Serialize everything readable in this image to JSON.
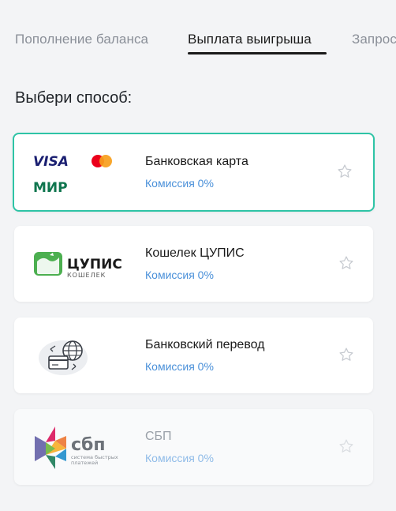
{
  "tabs": [
    {
      "label": "Пополнение баланса",
      "active": false
    },
    {
      "label": "Выплата выигрыша",
      "active": true
    },
    {
      "label": "Запрос",
      "active": false
    }
  ],
  "section_title": "Выбери способ:",
  "methods": [
    {
      "name": "Банковская карта",
      "fee": "Комиссия 0%",
      "selected": true,
      "disabled": false,
      "logo_text": [
        "VISA",
        "МИР"
      ]
    },
    {
      "name": "Кошелек ЦУПИС",
      "fee": "Комиссия 0%",
      "selected": false,
      "disabled": false,
      "logo_text": [
        "ЦУПИС",
        "КОШЕЛЕК"
      ]
    },
    {
      "name": "Банковский перевод",
      "fee": "Комиссия 0%",
      "selected": false,
      "disabled": false
    },
    {
      "name": "СБП",
      "fee": "Комиссия 0%",
      "selected": false,
      "disabled": true,
      "logo_text": [
        "сбп",
        "система быстрых",
        "платежей"
      ]
    }
  ],
  "colors": {
    "accent": "#2ec4a6",
    "fee": "#4a90d9",
    "visa": "#1a1f71",
    "mir": "#0f754e",
    "cupis": "#4caf50"
  }
}
